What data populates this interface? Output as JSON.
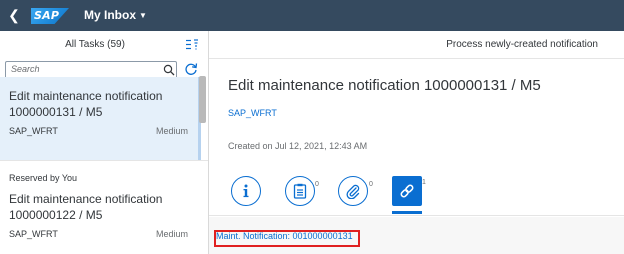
{
  "shell": {
    "logo_text": "SAP",
    "app_title": "My Inbox"
  },
  "master": {
    "title": "All Tasks (59)",
    "search_placeholder": "Search",
    "items": [
      {
        "title": "Edit maintenance notification 1000000131 / M5",
        "user": "SAP_WFRT",
        "priority": "Medium"
      },
      {
        "group": "Reserved by You",
        "title": "Edit maintenance notification 1000000122 / M5",
        "user": "SAP_WFRT",
        "priority": "Medium"
      }
    ]
  },
  "detail": {
    "header": "Process newly-created notification",
    "title": "Edit maintenance notification 1000000131 / M5",
    "created_by": "SAP_WFRT",
    "created_on": "Created on Jul 12, 2021, 12:43 AM",
    "tabs": [
      {
        "name": "info",
        "icon": "info-icon"
      },
      {
        "name": "notes",
        "icon": "notes-icon",
        "count": "0"
      },
      {
        "name": "attachments",
        "icon": "paperclip-icon",
        "count": "0"
      },
      {
        "name": "related-objects",
        "icon": "link-icon",
        "count": "1"
      }
    ],
    "related_object_link": "Maint. Notification: 001000000131"
  },
  "colors": {
    "shell": "#354a5f",
    "accent": "#0a6ed1",
    "selected_bg": "#e5f0fa",
    "highlight": "#e02020"
  }
}
